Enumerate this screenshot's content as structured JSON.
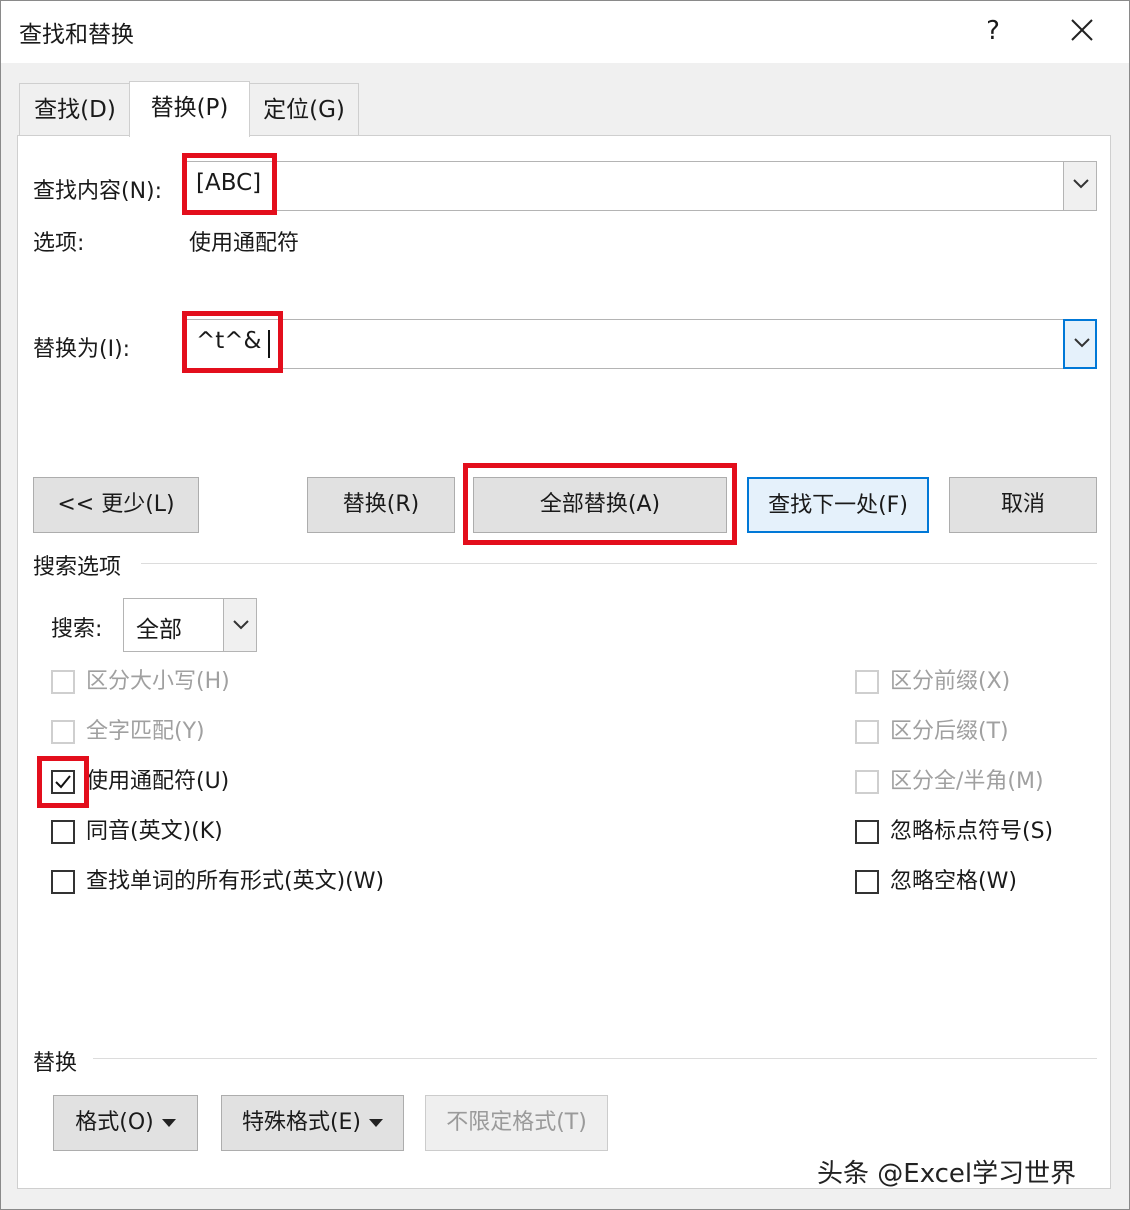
{
  "window": {
    "title": "查找和替换",
    "help": "?"
  },
  "tabs": [
    {
      "label": "查找(D)"
    },
    {
      "label": "替换(P)"
    },
    {
      "label": "定位(G)"
    }
  ],
  "find": {
    "label": "查找内容(N):",
    "value": "[ABC]"
  },
  "options": {
    "label": "选项:",
    "value": "使用通配符"
  },
  "replace": {
    "label": "替换为(I):",
    "value": "^t^&"
  },
  "buttons": {
    "less": "<< 更少(L)",
    "replace": "替换(R)",
    "replace_all": "全部替换(A)",
    "find_next": "查找下一处(F)",
    "cancel": "取消"
  },
  "search_options": {
    "heading": "搜索选项",
    "search_label": "搜索:",
    "search_value": "全部"
  },
  "checkboxes_left": [
    {
      "label": "区分大小写(H)",
      "checked": false,
      "enabled": false
    },
    {
      "label": "全字匹配(Y)",
      "checked": false,
      "enabled": false
    },
    {
      "label": "使用通配符(U)",
      "checked": true,
      "enabled": true
    },
    {
      "label": "同音(英文)(K)",
      "checked": false,
      "enabled": true
    },
    {
      "label": "查找单词的所有形式(英文)(W)",
      "checked": false,
      "enabled": true
    }
  ],
  "checkboxes_right": [
    {
      "label": "区分前缀(X)",
      "checked": false,
      "enabled": false
    },
    {
      "label": "区分后缀(T)",
      "checked": false,
      "enabled": false
    },
    {
      "label": "区分全/半角(M)",
      "checked": false,
      "enabled": false
    },
    {
      "label": "忽略标点符号(S)",
      "checked": false,
      "enabled": true
    },
    {
      "label": "忽略空格(W)",
      "checked": false,
      "enabled": true
    }
  ],
  "replace_section": {
    "heading": "替换",
    "format": "格式(O)",
    "special": "特殊格式(E)",
    "no_format": "不限定格式(T)"
  },
  "watermark": "头条 @Excel学习世界",
  "colors": {
    "highlight": "#e30e1c",
    "focus": "#0078d7"
  },
  "icons": {
    "close": "close-icon",
    "dropdown": "chevron-down-icon",
    "check": "checkmark-icon"
  }
}
